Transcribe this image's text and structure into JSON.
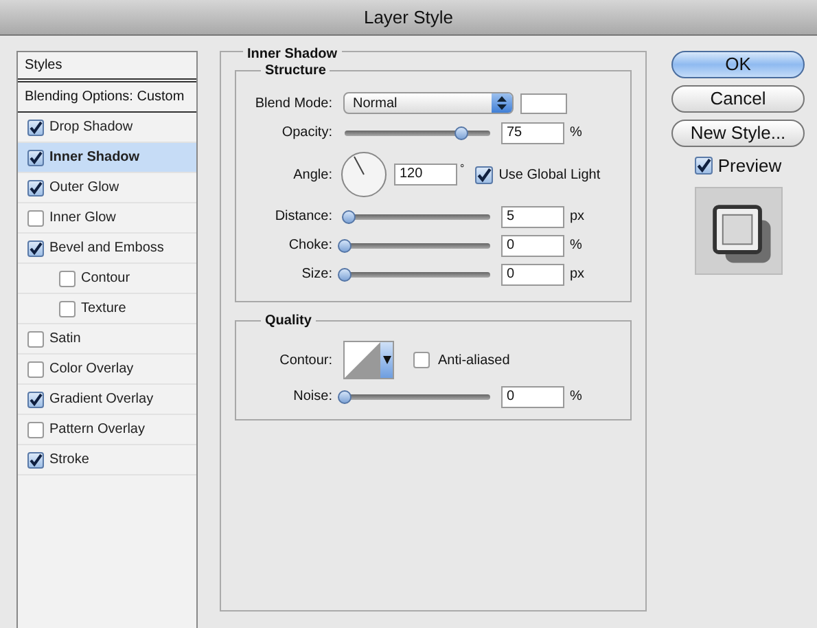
{
  "window": {
    "title": "Layer Style"
  },
  "styles_list": {
    "header": "Styles",
    "blending": "Blending Options: Custom",
    "items": [
      {
        "label": "Drop Shadow",
        "checked": true,
        "selected": false
      },
      {
        "label": "Inner Shadow",
        "checked": true,
        "selected": true
      },
      {
        "label": "Outer Glow",
        "checked": true,
        "selected": false
      },
      {
        "label": "Inner Glow",
        "checked": false,
        "selected": false
      },
      {
        "label": "Bevel and Emboss",
        "checked": true,
        "selected": false,
        "children": [
          {
            "label": "Contour",
            "checked": false,
            "selected": false
          },
          {
            "label": "Texture",
            "checked": false,
            "selected": false
          }
        ]
      },
      {
        "label": "Satin",
        "checked": false,
        "selected": false
      },
      {
        "label": "Color Overlay",
        "checked": false,
        "selected": false
      },
      {
        "label": "Gradient Overlay",
        "checked": true,
        "selected": false
      },
      {
        "label": "Pattern Overlay",
        "checked": false,
        "selected": false
      },
      {
        "label": "Stroke",
        "checked": true,
        "selected": false
      }
    ]
  },
  "panel": {
    "title": "Inner Shadow",
    "structure": {
      "title": "Structure",
      "blend_mode": {
        "label": "Blend Mode:",
        "value": "Normal"
      },
      "opacity": {
        "label": "Opacity:",
        "level": 0.8,
        "value": "75",
        "unit": "%"
      },
      "angle": {
        "label": "Angle:",
        "value": "120",
        "unit": "°",
        "use_global_light": {
          "label": "Use Global Light",
          "checked": true
        }
      },
      "distance": {
        "label": "Distance:",
        "level": 0.03,
        "value": "5",
        "unit": "px"
      },
      "choke": {
        "label": "Choke:",
        "level": 0,
        "value": "0",
        "unit": "%"
      },
      "size": {
        "label": "Size:",
        "level": 0,
        "value": "0",
        "unit": "px"
      }
    },
    "quality": {
      "title": "Quality",
      "contour": {
        "label": "Contour:"
      },
      "anti_aliased": {
        "label": "Anti-aliased",
        "checked": false
      },
      "noise": {
        "label": "Noise:",
        "level": 0,
        "value": "0",
        "unit": "%"
      }
    }
  },
  "buttons": [
    {
      "label": "OK",
      "kind": "default"
    },
    {
      "label": "Cancel",
      "kind": "normal"
    },
    {
      "label": "New Style...",
      "kind": "normal"
    }
  ],
  "preview": {
    "label": "Preview",
    "checked": true
  }
}
